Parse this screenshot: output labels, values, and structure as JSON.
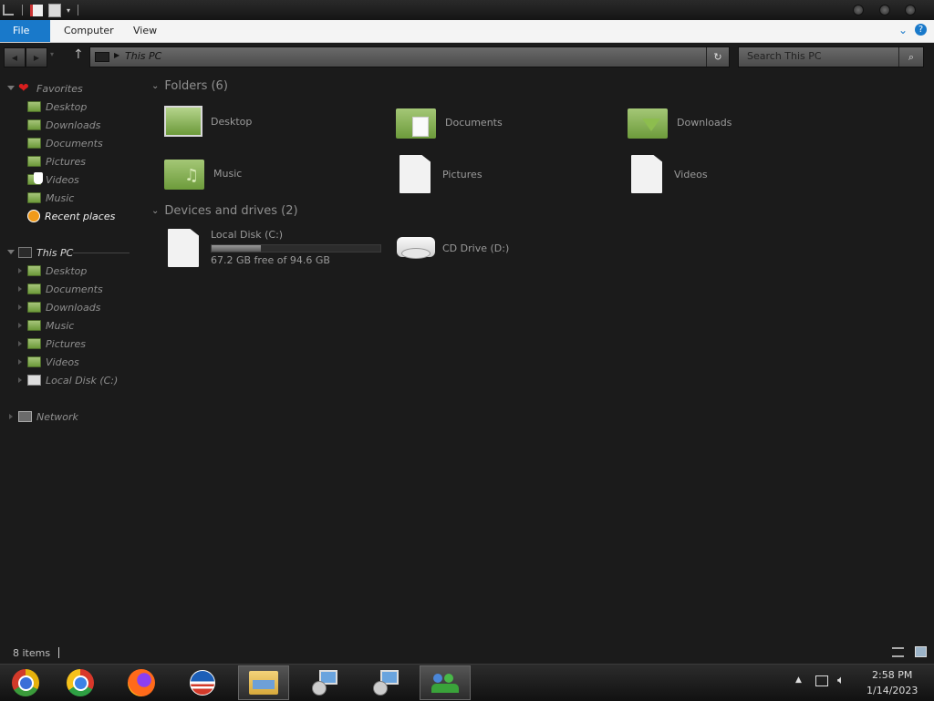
{
  "ribbon": {
    "file": "File",
    "computer": "Computer",
    "view": "View"
  },
  "address": {
    "path": "This PC"
  },
  "search": {
    "placeholder": "Search This PC"
  },
  "sidebar": {
    "favorites": {
      "label": "Favorites",
      "items": [
        "Desktop",
        "Downloads",
        "Documents",
        "Pictures",
        "Videos",
        "Music",
        "Recent places"
      ]
    },
    "thispc": {
      "label": "This PC",
      "items": [
        "Desktop",
        "Documents",
        "Downloads",
        "Music",
        "Pictures",
        "Videos",
        "Local Disk (C:)"
      ]
    },
    "network": {
      "label": "Network"
    }
  },
  "main": {
    "folders_header": "Folders (6)",
    "folders": [
      "Desktop",
      "Documents",
      "Downloads",
      "Music",
      "Pictures",
      "Videos"
    ],
    "devices_header": "Devices and drives (2)",
    "drives": [
      {
        "name": "Local Disk (C:)",
        "free": "67.2 GB free of 94.6 GB",
        "used_fraction": 0.29
      },
      {
        "name": "CD Drive (D:)"
      }
    ]
  },
  "status": {
    "items": "8 items"
  },
  "taskbar": {
    "time": "2:58 PM",
    "date": "1/14/2023"
  },
  "colors": {
    "accent": "#1979ca",
    "folder_green": "#8db35a",
    "background": "#1b1b1b"
  },
  "icons": [
    "chrome-icon",
    "chrome-icon",
    "firefox-icon",
    "obama-logo-icon",
    "file-explorer-icon",
    "installer-icon",
    "installer-icon",
    "network-users-icon"
  ]
}
